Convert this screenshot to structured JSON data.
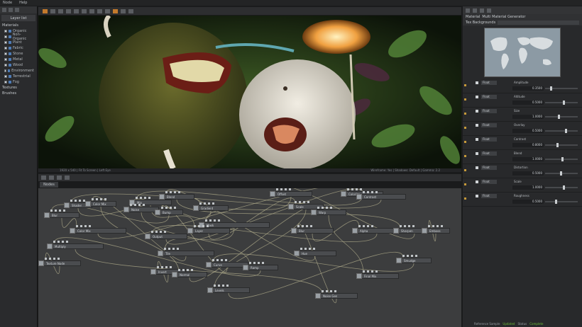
{
  "menu": {
    "items": [
      "Node",
      "Help"
    ]
  },
  "left_panel": {
    "tab_label": "Layer list",
    "materials_label": "Materials",
    "tree_items": [
      "Organic",
      "Non-Organic",
      "Plant",
      "Fabric",
      "Stone",
      "Metal",
      "Wood",
      "Environment",
      "Terrestrial",
      "Fog"
    ],
    "textures_label": "Textures",
    "brushes_label": "Brushes"
  },
  "viewport": {
    "status_left": "1920 x 540  |  Fit To Screen  |  Left Eye",
    "status_right": "Wireframe: Yes  |  Shadows: Default  |  Gamma: 2.2"
  },
  "node_editor": {
    "tab_label": "Nodes",
    "nodes": [
      {
        "label": "Blur",
        "name": "node-blur"
      },
      {
        "label": "Shader",
        "name": "node-shader"
      },
      {
        "label": "Color Mix",
        "name": "node-color-mix"
      },
      {
        "label": "Color Mix",
        "name": "node-color-mix-2"
      },
      {
        "label": "Multiply",
        "name": "node-multiply"
      },
      {
        "label": "Texture Node",
        "name": "node-texture-node"
      },
      {
        "label": "Mix",
        "name": "node-mix"
      },
      {
        "label": "Noise",
        "name": "node-noise"
      },
      {
        "label": "Blend",
        "name": "node-blend"
      },
      {
        "label": "Bump",
        "name": "node-bump"
      },
      {
        "label": "Gradient",
        "name": "node-gradient"
      },
      {
        "label": "Mask",
        "name": "node-mask"
      },
      {
        "label": "Layer",
        "name": "node-layer"
      },
      {
        "label": "Output",
        "name": "node-output"
      },
      {
        "label": "Tile",
        "name": "node-tile"
      },
      {
        "label": "Curve",
        "name": "node-curve"
      },
      {
        "label": "Invert",
        "name": "node-invert"
      },
      {
        "label": "Normal",
        "name": "node-normal"
      },
      {
        "label": "Levels",
        "name": "node-levels"
      },
      {
        "label": "Ramp",
        "name": "node-ramp"
      },
      {
        "label": "Offset",
        "name": "node-offset"
      },
      {
        "label": "Scale",
        "name": "node-scale"
      },
      {
        "label": "Blur",
        "name": "node-blur-2"
      },
      {
        "label": "Warp",
        "name": "node-warp"
      },
      {
        "label": "Colorize",
        "name": "node-colorize"
      },
      {
        "label": "Alpha",
        "name": "node-alpha"
      },
      {
        "label": "Sharpen",
        "name": "node-sharpen"
      },
      {
        "label": "Emboss",
        "name": "node-emboss"
      },
      {
        "label": "Contrast",
        "name": "node-contrast"
      },
      {
        "label": "Hue",
        "name": "node-hue"
      },
      {
        "label": "Smudge",
        "name": "node-smudge"
      },
      {
        "label": "Noise Gen",
        "name": "node-noise-gen"
      },
      {
        "label": "Final Mix",
        "name": "node-final-mix"
      }
    ]
  },
  "right_panel": {
    "header_label": "Material",
    "header_value": "Multi Material Generator",
    "sub_label": "Tex Backgrounds",
    "params": [
      {
        "label": "Amplitude",
        "value": "0.3500",
        "position": 0.15
      },
      {
        "label": "Altitude",
        "value": "0.5000",
        "position": 0.55
      },
      {
        "label": "Size",
        "value": "1.0000",
        "position": 0.4
      },
      {
        "label": "Overlay",
        "value": "0.5000",
        "position": 0.6
      },
      {
        "label": "Contrast",
        "value": "0.8000",
        "position": 0.35
      },
      {
        "label": "Blend",
        "value": "1.0000",
        "position": 0.5
      },
      {
        "label": "Distortion",
        "value": "0.5000",
        "position": 0.45
      },
      {
        "label": "Scale",
        "value": "1.0000",
        "position": 0.55
      },
      {
        "label": "Roughness",
        "value": "0.5000",
        "position": 0.3
      }
    ],
    "status_label": "Reference Sample",
    "status_value": "Updated",
    "status_label2": "Status",
    "status_value2": "Complete"
  },
  "colors": {
    "accent": "#c47a2c",
    "ok": "#6fbf3a"
  }
}
